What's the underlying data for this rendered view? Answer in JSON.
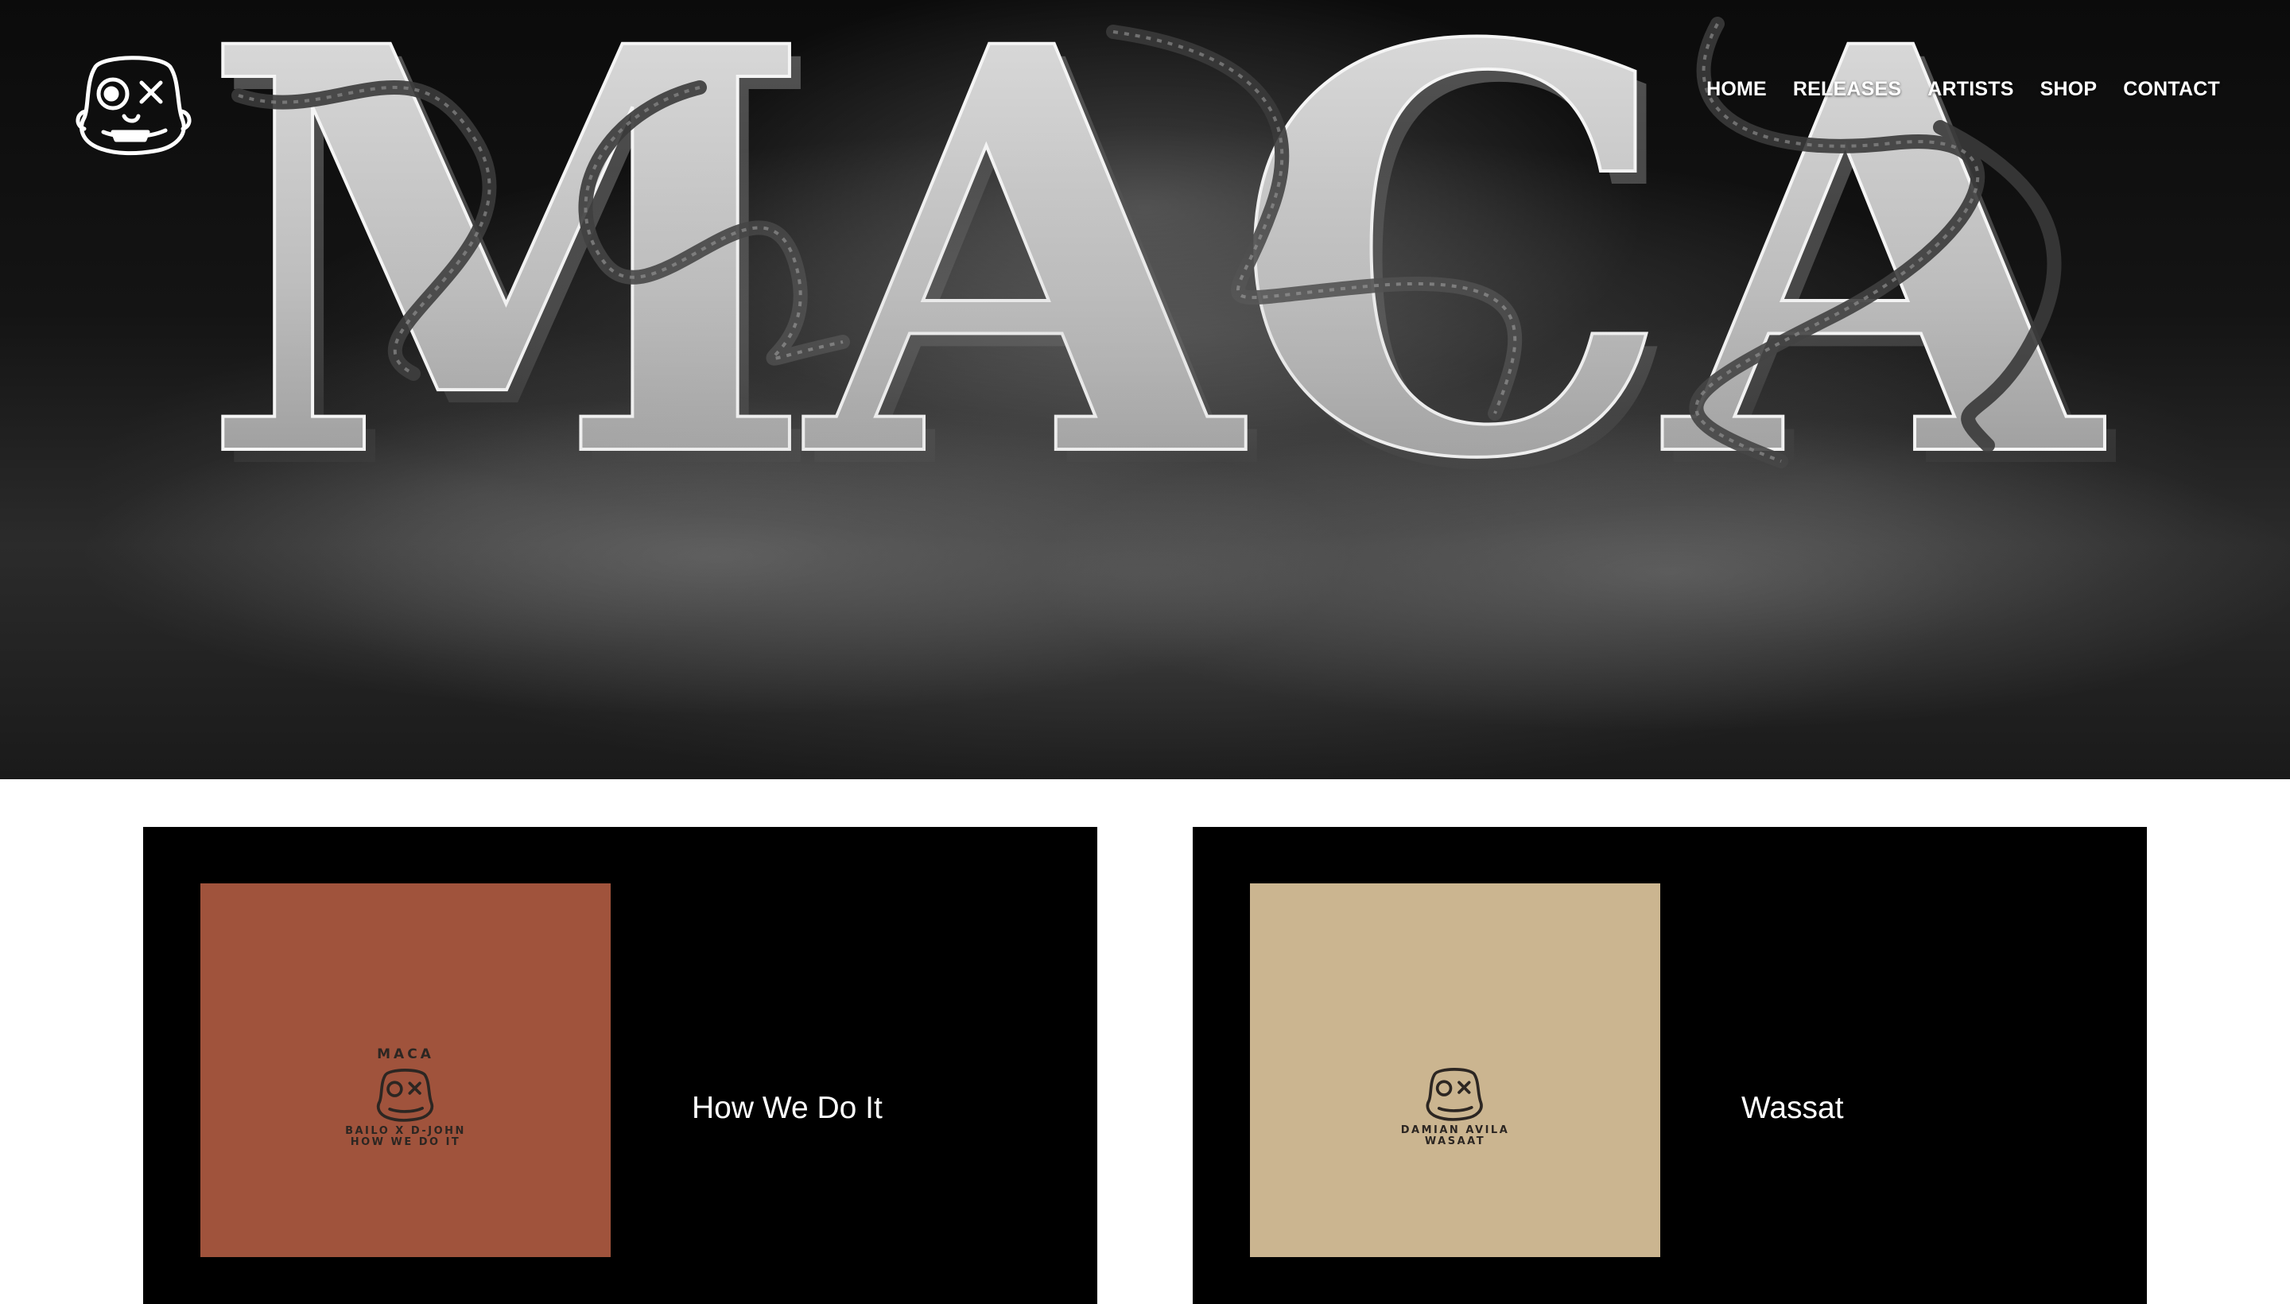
{
  "site": {
    "logo_icon": "skull-face-logo-icon",
    "hero_word": "MACA"
  },
  "nav": {
    "items": [
      {
        "label": "HOME"
      },
      {
        "label": "RELEASES"
      },
      {
        "label": "ARTISTS"
      },
      {
        "label": "SHOP"
      },
      {
        "label": "CONTACT"
      }
    ]
  },
  "releases": [
    {
      "title": "How We Do It",
      "cover_top_text": "MACA",
      "cover_bottom_text": "BAILO X D-JOHN\nHOW WE DO IT",
      "cover_color": "#a0533c",
      "cover_icon": "skull-face-icon"
    },
    {
      "title": "Wassat",
      "cover_top_text": "",
      "cover_bottom_text": "DAMIAN AVILA\nWASAAT",
      "cover_color": "#cbb590",
      "cover_icon": "skull-face-icon"
    }
  ],
  "colors": {
    "page_bg": "#ffffff",
    "card_bg": "#000000",
    "nav_text": "#ffffff"
  }
}
